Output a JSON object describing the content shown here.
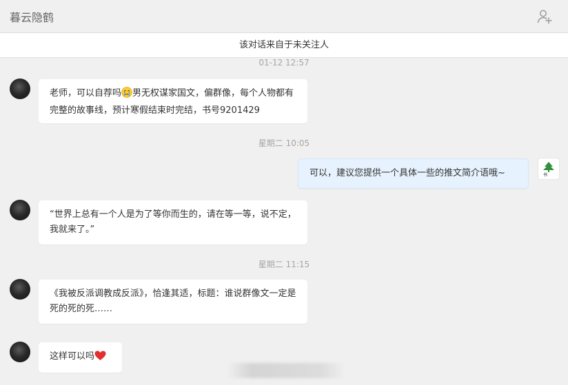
{
  "header": {
    "title": "暮云隐鹤",
    "add_contact_icon": "add-user-icon"
  },
  "notice": "该对话来自于未关注人",
  "messages": [
    {
      "timestamp": "01-12 12:57",
      "direction": "in",
      "text_before": "老师，可以自荐吗",
      "emoji": "crying-face",
      "text_after": "男无权谋家国文，偏群像，每个人物都有完整的故事线，预计寒假结束时完结，书号9201429"
    },
    {
      "timestamp": "星期二 10:05",
      "direction": "out",
      "text": "可以，建议您提供一个具体一些的推文简介语哦~"
    },
    {
      "direction": "in",
      "text": "“世界上总有一个人是为了等你而生的，请在等一等，说不定，我就来了。”"
    },
    {
      "timestamp": "星期二 11:15",
      "direction": "in",
      "text": "《我被反派调教成反派》，恰逢其适，标题：谁说群像文一定是死的死的死……"
    },
    {
      "direction": "in",
      "text": "这样可以吗",
      "emoji": "red-heart"
    }
  ],
  "colors": {
    "background": "#f0f0f0",
    "incoming_bubble": "#ffffff",
    "outgoing_bubble": "#e6f2fd",
    "timestamp": "#a5a5a5",
    "heart": "#e0302f"
  }
}
